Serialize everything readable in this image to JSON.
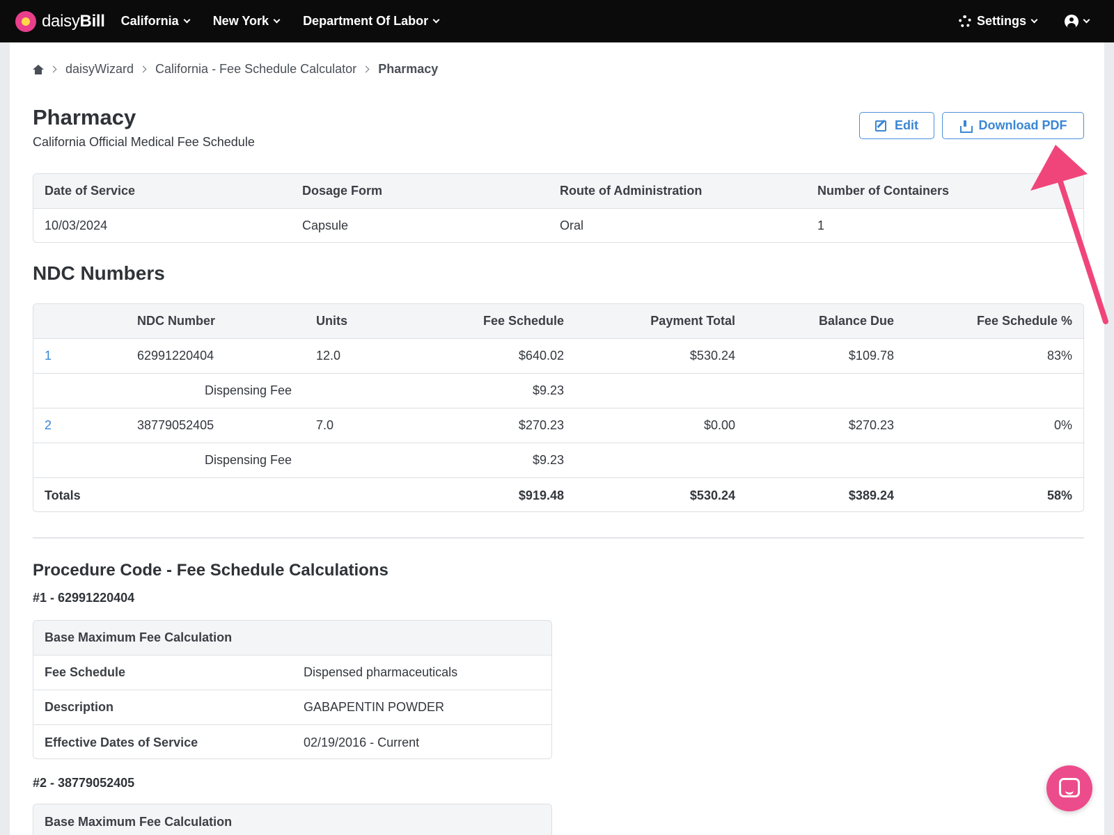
{
  "nav": {
    "brand_prefix": "daisy",
    "brand_suffix": "Bill",
    "menus": [
      "California",
      "New York",
      "Department Of Labor"
    ],
    "settings_label": "Settings"
  },
  "breadcrumb": {
    "items": [
      "daisyWizard",
      "California - Fee Schedule Calculator"
    ],
    "current": "Pharmacy"
  },
  "page": {
    "title": "Pharmacy",
    "subtitle": "California Official Medical Fee Schedule",
    "edit_label": "Edit",
    "download_label": "Download PDF"
  },
  "info": {
    "headers": [
      "Date of Service",
      "Dosage Form",
      "Route of Administration",
      "Number of Containers"
    ],
    "values": [
      "10/03/2024",
      "Capsule",
      "Oral",
      "1"
    ]
  },
  "ndc": {
    "title": "NDC Numbers",
    "headers": [
      "NDC Number",
      "Units",
      "Fee Schedule",
      "Payment Total",
      "Balance Due",
      "Fee Schedule %"
    ],
    "rows": [
      {
        "index": "1",
        "ndc": "62991220404",
        "units": "12.0",
        "fee": "$640.02",
        "payment": "$530.24",
        "balance": "$109.78",
        "pct": "83%"
      },
      {
        "label": "Dispensing Fee",
        "fee": "$9.23"
      },
      {
        "index": "2",
        "ndc": "38779052405",
        "units": "7.0",
        "fee": "$270.23",
        "payment": "$0.00",
        "balance": "$270.23",
        "pct": "0%"
      },
      {
        "label": "Dispensing Fee",
        "fee": "$9.23"
      }
    ],
    "totals": {
      "label": "Totals",
      "fee": "$919.48",
      "payment": "$530.24",
      "balance": "$389.24",
      "pct": "58%"
    }
  },
  "procedure": {
    "title": "Procedure Code - Fee Schedule Calculations",
    "items": [
      {
        "heading": "#1 - 62991220404",
        "table_title": "Base Maximum Fee Calculation",
        "rows": [
          {
            "label": "Fee Schedule",
            "value": "Dispensed pharmaceuticals"
          },
          {
            "label": "Description",
            "value": "GABAPENTIN POWDER"
          },
          {
            "label": "Effective Dates of Service",
            "value": "02/19/2016 - Current"
          }
        ]
      },
      {
        "heading": "#2 - 38779052405",
        "table_title": "Base Maximum Fee Calculation"
      }
    ]
  },
  "colors": {
    "accent": "#3a86d4",
    "annotation_arrow": "#f0457a",
    "chat_bubble": "#ec4c8b",
    "nav_bg": "#0b0b0c"
  }
}
